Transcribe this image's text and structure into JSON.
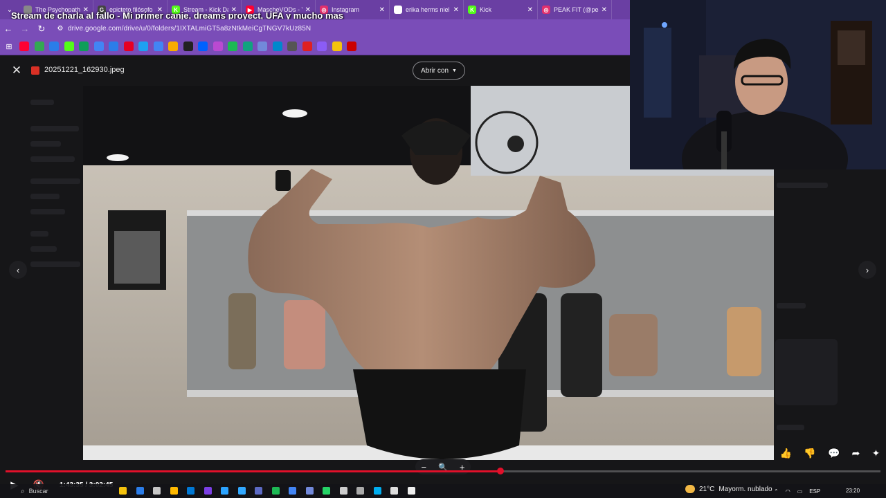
{
  "stream_title": "Stream de charla al fallo - Mi primer canje, dreams proyect, UFA y mucho mas",
  "browser": {
    "tabs": [
      {
        "title": "The Psychopath in",
        "color": "#888888",
        "glyph": ""
      },
      {
        "title": "epicteto filósofo",
        "color": "#444444",
        "glyph": "G"
      },
      {
        "title": "Stream - Kick Das",
        "color": "#53fc18",
        "glyph": "K"
      },
      {
        "title": "MascheVODs - Yo",
        "color": "#ff0033",
        "glyph": "▶"
      },
      {
        "title": "Instagram",
        "color": "#e1306c",
        "glyph": "◎"
      },
      {
        "title": "erika herms niel",
        "color": "#ffffff",
        "glyph": "G"
      },
      {
        "title": "Kick",
        "color": "#53fc18",
        "glyph": "K"
      },
      {
        "title": "PEAK FIT (@peakf",
        "color": "#e1306c",
        "glyph": "◎"
      }
    ],
    "tab_close_glyph": "✕",
    "url": "drive.google.com/drive/u/0/folders/1IXTALmiGT5a8zNtkMeiCgTNGV7kUz85N",
    "bookmark_colors": [
      "#ff0033",
      "#34a853",
      "#2b7de9",
      "#53fc18",
      "#0f9d58",
      "#4285f4",
      "#2b7de9",
      "#e60023",
      "#1da1f2",
      "#4285f4",
      "#f9ab00",
      "#222222",
      "#0061ff",
      "#b94ad1",
      "#1db954",
      "#10a37f",
      "#7289da",
      "#0088cc",
      "#555555",
      "#e02020",
      "#8b5cf6",
      "#f4c20d",
      "#cc0000"
    ]
  },
  "viewer": {
    "file_name": "20251221_162930.jpeg",
    "open_with_label": "Abrir con",
    "close_icon": "✕",
    "prev_arrow": "‹",
    "next_arrow": "›",
    "zoom_out": "−",
    "zoom_icon": "🔍",
    "zoom_in": "+"
  },
  "player": {
    "time": "1:43:35 / 3:02:45",
    "progress_fraction": 0.566,
    "play_icon": "▶",
    "mute_icon": "🔇",
    "actions": [
      "👍",
      "👎",
      "💬",
      "➦",
      "✦"
    ]
  },
  "taskbar": {
    "search_placeholder": "Buscar",
    "search_icon": "⌕",
    "weather_temp": "21°C",
    "weather_desc": "Mayorm. nublado",
    "language": "ESP",
    "clock": "23:20",
    "icon_colors": [
      "#f4c20d",
      "#2b7de9",
      "#c6c6c6",
      "#ffb900",
      "#0078d4",
      "#7b3fe4",
      "#2ba3ff",
      "#31a8ff",
      "#5c6ac4",
      "#1db954",
      "#4285f4",
      "#7289da",
      "#25d366",
      "#cccccc",
      "#aaaaaa",
      "#00adef",
      "#dddddd",
      "#eeeeee"
    ]
  },
  "colors": {
    "tab_bar": "#6a3fa3",
    "address_bar": "#7a4db8",
    "accent_red": "#e0102a"
  }
}
